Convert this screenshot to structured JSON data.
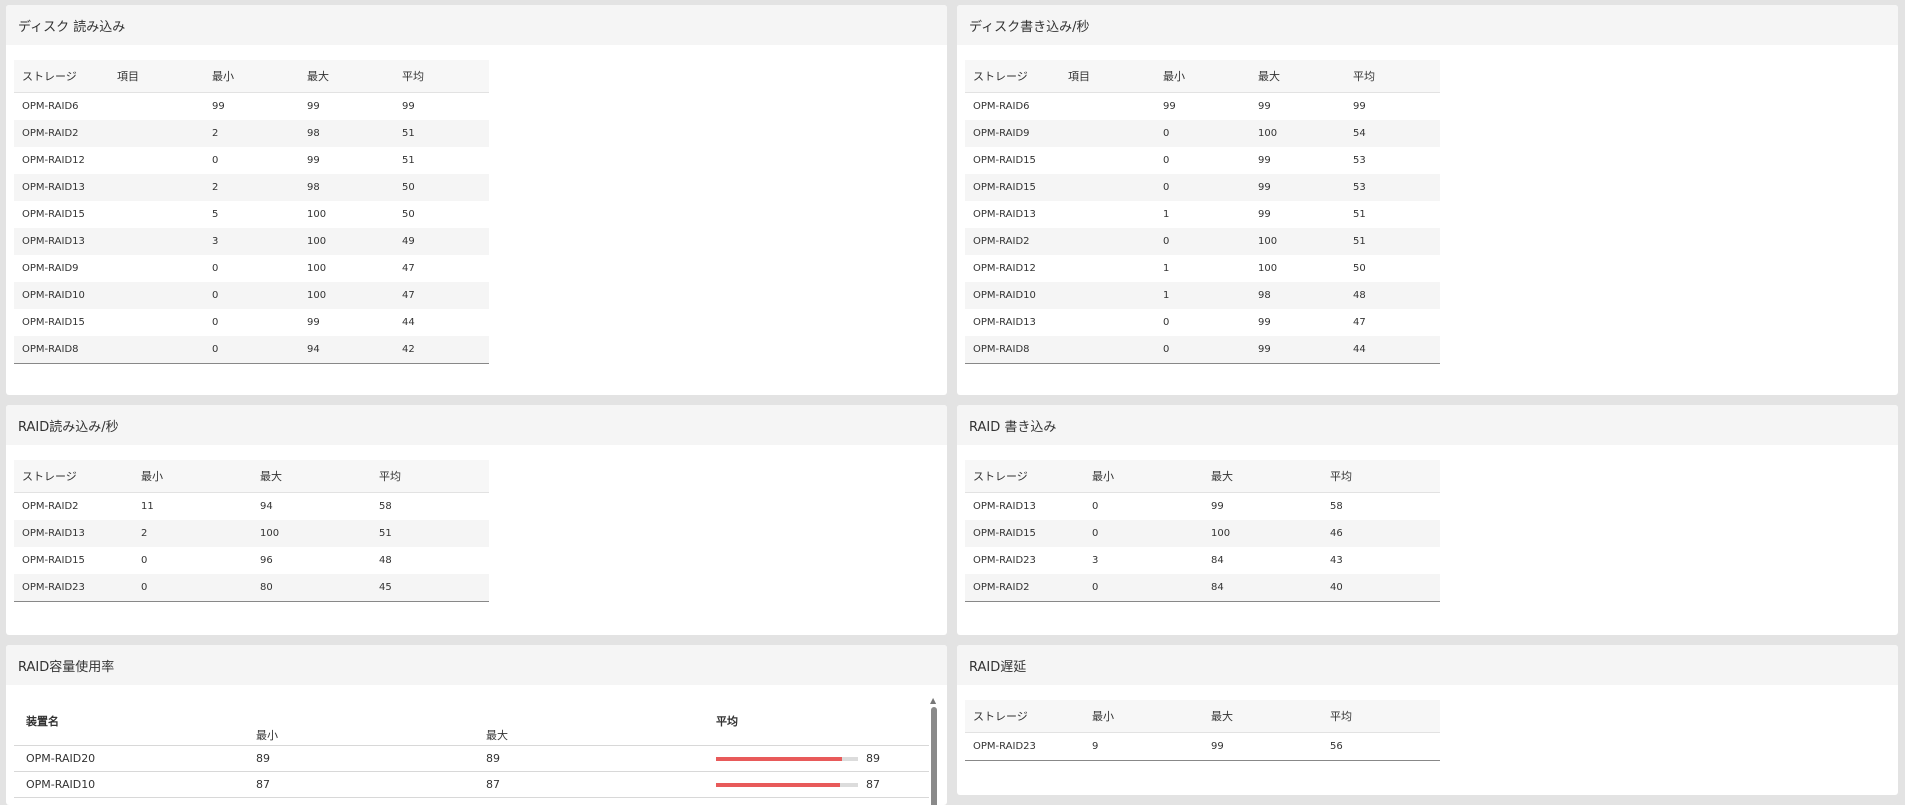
{
  "disk_read": {
    "title": "ディスク 読み込み",
    "columns": [
      "ストレージ",
      "項目",
      "最小",
      "最大",
      "平均"
    ],
    "rows": [
      [
        "OPM-RAID6",
        "",
        "99",
        "99",
        "99"
      ],
      [
        "OPM-RAID2",
        "",
        "2",
        "98",
        "51"
      ],
      [
        "OPM-RAID12",
        "",
        "0",
        "99",
        "51"
      ],
      [
        "OPM-RAID13",
        "",
        "2",
        "98",
        "50"
      ],
      [
        "OPM-RAID15",
        "",
        "5",
        "100",
        "50"
      ],
      [
        "OPM-RAID13",
        "",
        "3",
        "100",
        "49"
      ],
      [
        "OPM-RAID9",
        "",
        "0",
        "100",
        "47"
      ],
      [
        "OPM-RAID10",
        "",
        "0",
        "100",
        "47"
      ],
      [
        "OPM-RAID15",
        "",
        "0",
        "99",
        "44"
      ],
      [
        "OPM-RAID8",
        "",
        "0",
        "94",
        "42"
      ]
    ]
  },
  "disk_write": {
    "title": "ディスク書き込み/秒",
    "columns": [
      "ストレージ",
      "項目",
      "最小",
      "最大",
      "平均"
    ],
    "rows": [
      [
        "OPM-RAID6",
        "",
        "99",
        "99",
        "99"
      ],
      [
        "OPM-RAID9",
        "",
        "0",
        "100",
        "54"
      ],
      [
        "OPM-RAID15",
        "",
        "0",
        "99",
        "53"
      ],
      [
        "OPM-RAID15",
        "",
        "0",
        "99",
        "53"
      ],
      [
        "OPM-RAID13",
        "",
        "1",
        "99",
        "51"
      ],
      [
        "OPM-RAID2",
        "",
        "0",
        "100",
        "51"
      ],
      [
        "OPM-RAID12",
        "",
        "1",
        "100",
        "50"
      ],
      [
        "OPM-RAID10",
        "",
        "1",
        "98",
        "48"
      ],
      [
        "OPM-RAID13",
        "",
        "0",
        "99",
        "47"
      ],
      [
        "OPM-RAID8",
        "",
        "0",
        "99",
        "44"
      ]
    ]
  },
  "raid_read": {
    "title": "RAID読み込み/秒",
    "columns": [
      "ストレージ",
      "最小",
      "最大",
      "平均"
    ],
    "rows": [
      [
        "OPM-RAID2",
        "11",
        "94",
        "58"
      ],
      [
        "OPM-RAID13",
        "2",
        "100",
        "51"
      ],
      [
        "OPM-RAID15",
        "0",
        "96",
        "48"
      ],
      [
        "OPM-RAID23",
        "0",
        "80",
        "45"
      ]
    ]
  },
  "raid_write": {
    "title": "RAID 書き込み",
    "columns": [
      "ストレージ",
      "最小",
      "最大",
      "平均"
    ],
    "rows": [
      [
        "OPM-RAID13",
        "0",
        "99",
        "58"
      ],
      [
        "OPM-RAID15",
        "0",
        "100",
        "46"
      ],
      [
        "OPM-RAID23",
        "3",
        "84",
        "43"
      ],
      [
        "OPM-RAID2",
        "0",
        "84",
        "40"
      ]
    ]
  },
  "raid_capacity": {
    "title": "RAID容量使用率",
    "columns": [
      "装置名",
      "最小",
      "最大",
      "平均"
    ],
    "rows": [
      {
        "name": "OPM-RAID20",
        "min": "89",
        "max": "89",
        "avg": "89",
        "avg_pct": 89
      },
      {
        "name": "OPM-RAID10",
        "min": "87",
        "max": "87",
        "avg": "87",
        "avg_pct": 87
      }
    ],
    "scroll_up_icon": "triangle-up-icon"
  },
  "raid_latency": {
    "title": "RAID遅延",
    "columns": [
      "ストレージ",
      "最小",
      "最大",
      "平均"
    ],
    "rows": [
      [
        "OPM-RAID23",
        "9",
        "99",
        "56"
      ]
    ]
  },
  "colors": {
    "bar_fill": "#e85a5a",
    "bar_track": "#dcdcdc",
    "panel_header": "#f5f5f5",
    "background": "#e3e3e3"
  }
}
